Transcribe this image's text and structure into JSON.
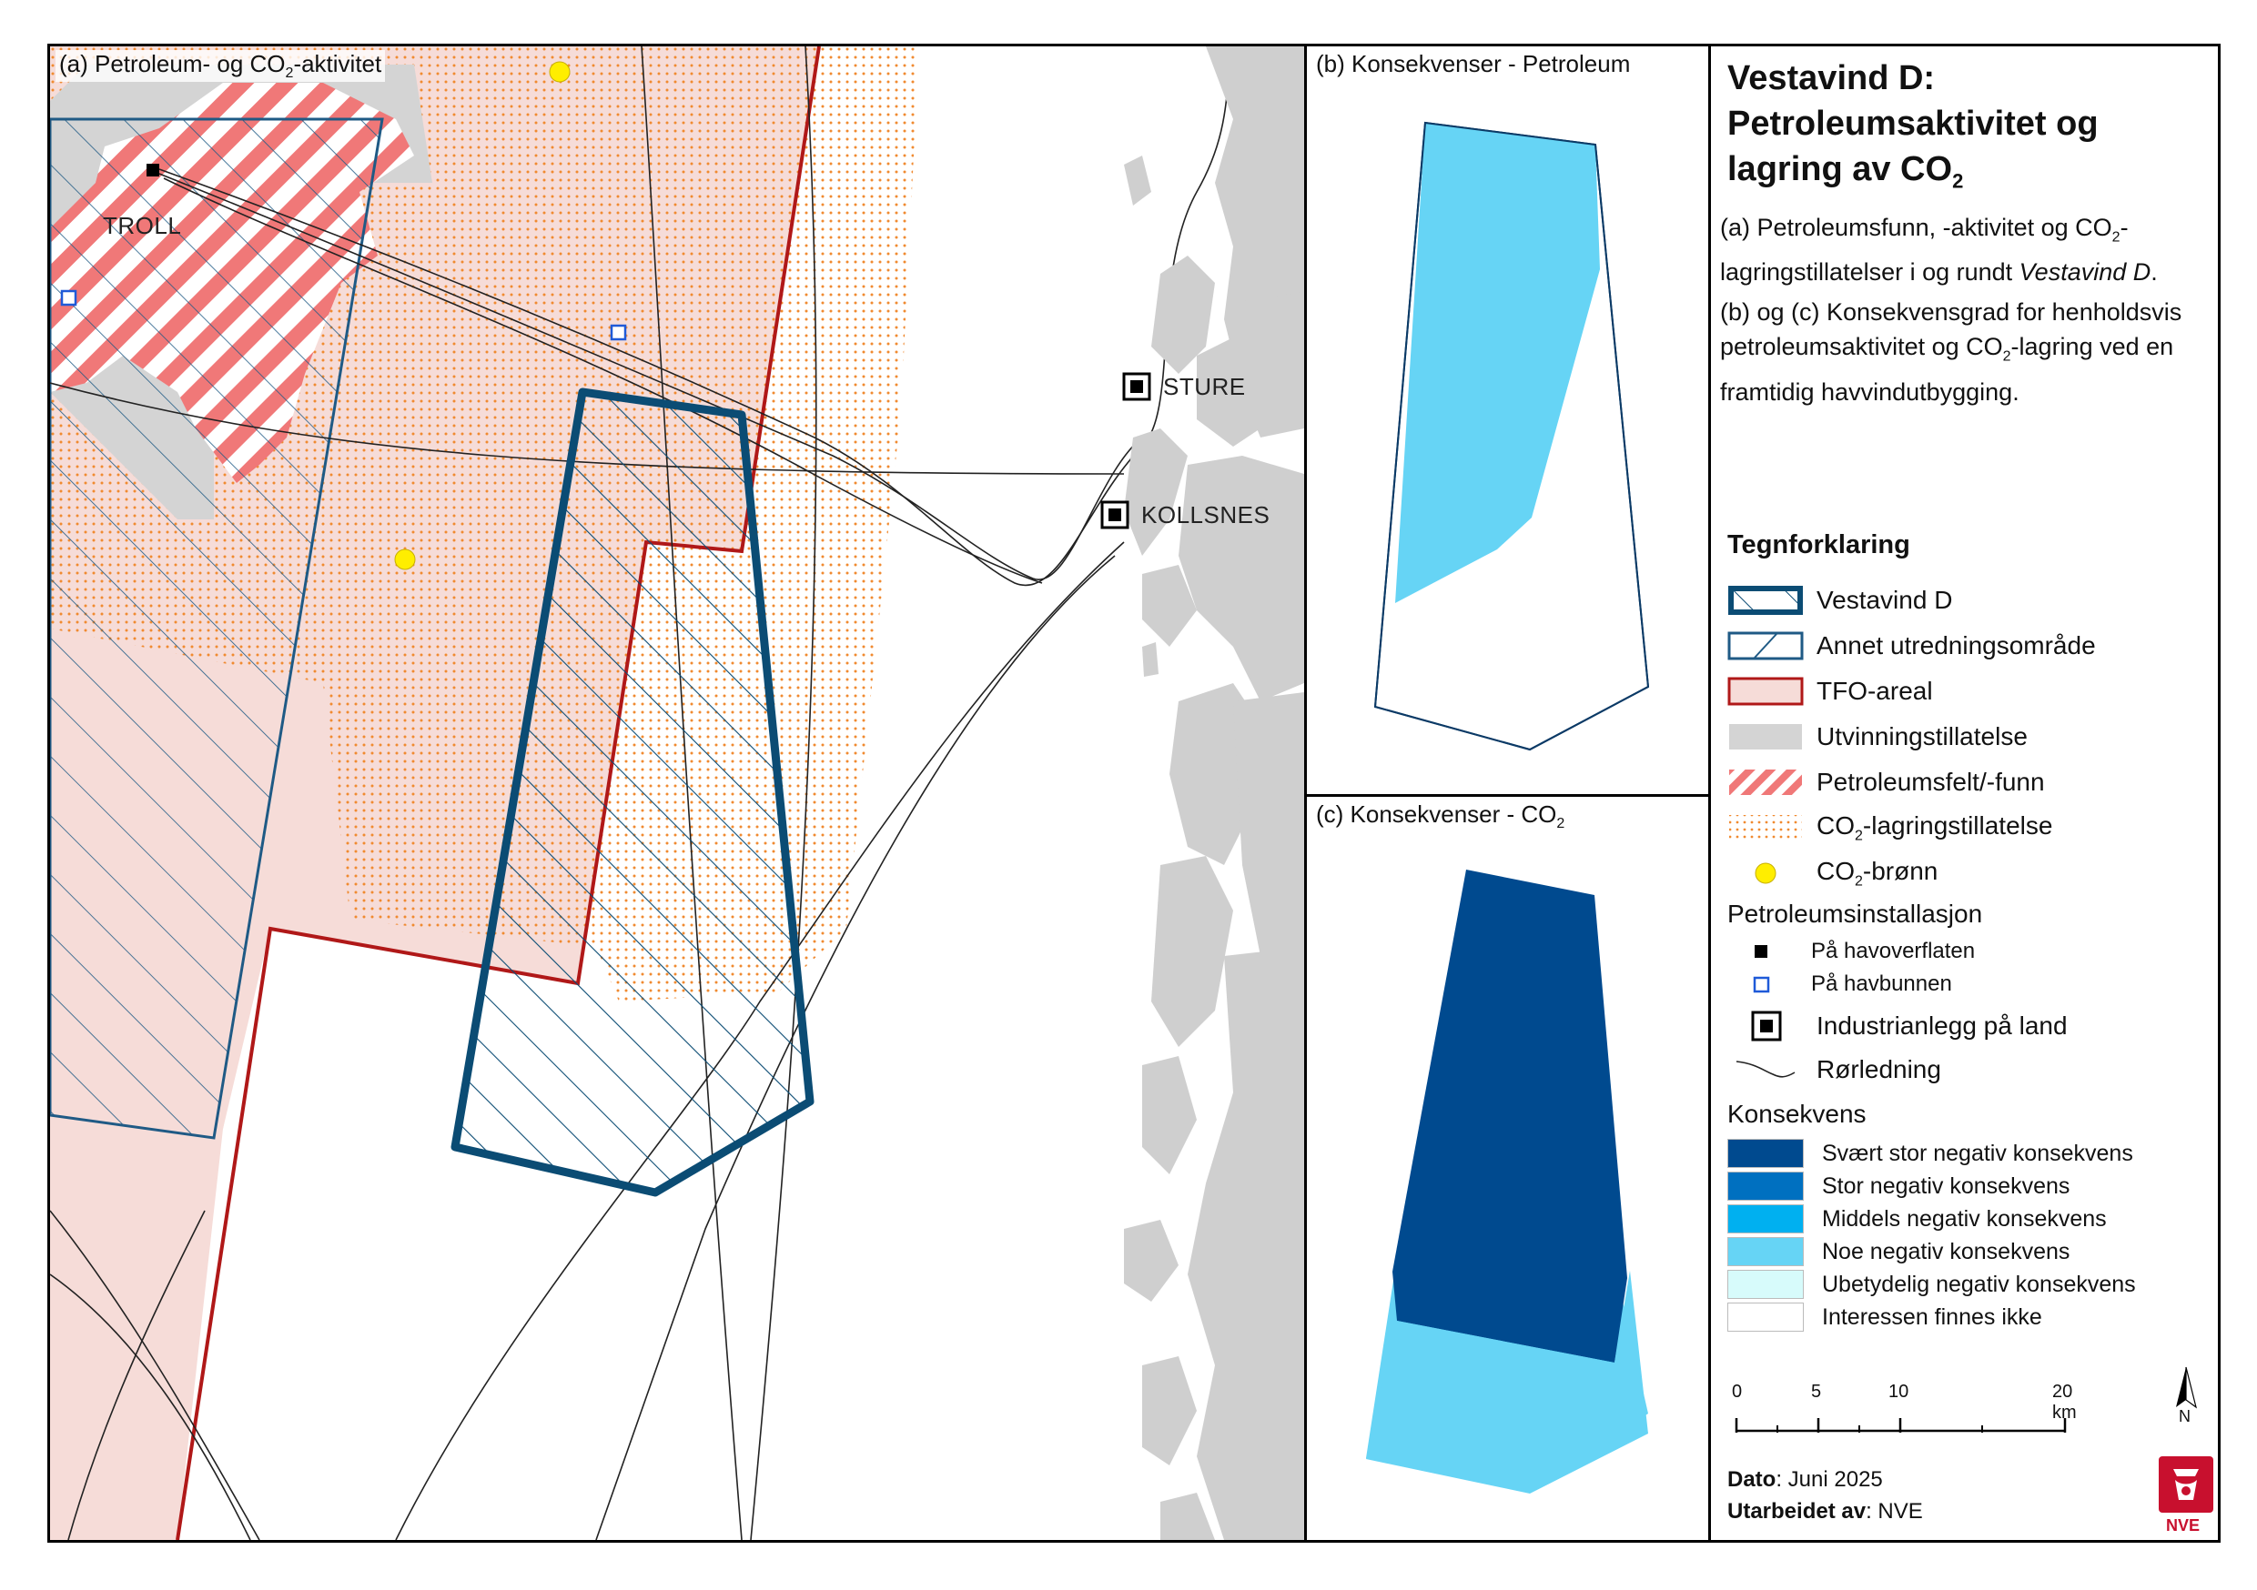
{
  "panel_a": {
    "title_pre": "(a) Petroleum- og CO",
    "title_sub": "2",
    "title_post": "-aktivitet",
    "places": [
      "TROLL",
      "STURE",
      "KOLLSNES"
    ]
  },
  "panel_b": {
    "title": "(b) Konsekvenser - Petroleum"
  },
  "panel_c": {
    "title_pre": "(c) Konsekvenser - CO",
    "title_sub": "2"
  },
  "side": {
    "title_line1": "Vestavind D:",
    "title_line2": "Petroleumsaktivitet og",
    "title_line3_pre": "lagring av CO",
    "title_line3_sub": "2",
    "desc_a_pre": "(a) Petroleumsfunn, -aktivitet og CO",
    "desc_a_sub": "2",
    "desc_a_mid": "-lagringstillatelser i og rundt ",
    "desc_a_it": "Vestavind D",
    "desc_a_end": ".",
    "desc_b_pre": "(b) og (c) Konsekvensgrad for henholdsvis petroleumsaktivitet og CO",
    "desc_b_sub": "2",
    "desc_b_end": "-lagring ved en framtidig havvindutbygging.",
    "legend_title": "Tegnforklaring",
    "legend": [
      "Vestavind D",
      "Annet utredningsområde",
      "TFO-areal",
      "Utvinningstillatelse",
      "Petroleumsfelt/-funn"
    ],
    "legend_co2_lagring_pre": "CO",
    "legend_co2_lagring_sub": "2",
    "legend_co2_lagring_post": "-lagringstillatelse",
    "legend_co2_bronn_pre": "CO",
    "legend_co2_bronn_sub": "2",
    "legend_co2_bronn_post": "-brønn",
    "installasjon_title": "Petroleumsinstallasjon",
    "installasjon": [
      "På havoverflaten",
      "På havbunnen"
    ],
    "industri": "Industrianlegg på land",
    "rorledning": "Rørledning",
    "konsekvens_title": "Konsekvens",
    "konsekvens": [
      {
        "label": "Svært stor negativ konsekvens",
        "color": "#004a8f"
      },
      {
        "label": "Stor negativ konsekvens",
        "color": "#0070c0"
      },
      {
        "label": "Middels negativ konsekvens",
        "color": "#00b0f0"
      },
      {
        "label": "Noe negativ konsekvens",
        "color": "#66d4f5"
      },
      {
        "label": "Ubetydelig negativ konsekvens",
        "color": "#d7fbfb"
      },
      {
        "label": "Interessen finnes ikke",
        "color": "#ffffff"
      }
    ],
    "scale_ticks": [
      "0",
      "5",
      "10",
      "20 km"
    ],
    "north": "N",
    "dato_label": "Dato",
    "dato_value": ": Juni 2025",
    "utarbeidet_label": "Utarbeidet av",
    "utarbeidet_value": ": NVE",
    "logo_text": "NVE"
  },
  "colors": {
    "vestavind": "#0b4c74",
    "tfo_line": "#b01818",
    "tfo_fill": "#f6dcd8",
    "utvinning": "#d4d4d4",
    "petro_stripe": "#f07878",
    "co2_dots": "#f08a30",
    "co2_well": "#ffee00",
    "land": "#cfcfcf"
  }
}
